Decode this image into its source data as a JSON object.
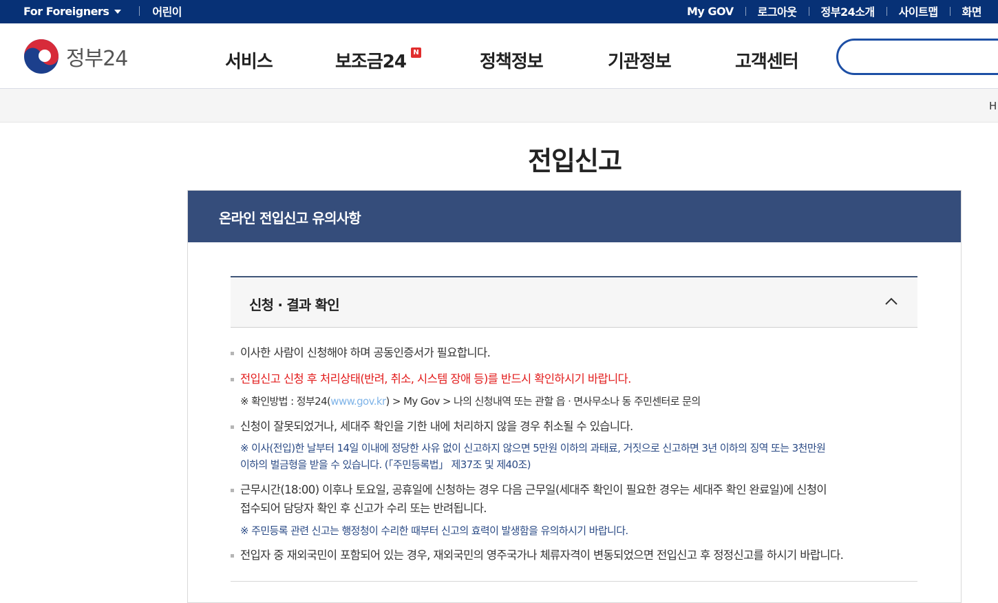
{
  "topbar": {
    "for_foreigners": "For Foreigners",
    "kids": "어린이",
    "my_gov": "My GOV",
    "logout": "로그아웃",
    "about": "정부24소개",
    "sitemap": "사이트맵",
    "screen": "화면"
  },
  "logo": {
    "text": "정부24"
  },
  "gnb": {
    "services": "서비스",
    "subsidy": "보조금24",
    "subsidy_badge": "N",
    "policy": "정책정보",
    "agency": "기관정보",
    "customer": "고객센터"
  },
  "search": {
    "placeholder": ""
  },
  "location": {
    "home": "H"
  },
  "page": {
    "title": "전입신고"
  },
  "notice": {
    "title": "온라인 전입신고 유의사항",
    "section_title": "신청 · 결과 확인",
    "item1": "이사한 사람이 신청해야 하며 공동인증서가 필요합니다.",
    "item2": "전입신고 신청 후 처리상태(반려, 취소, 시스템 장애 등)를 반드시 확인하시기 바랍니다.",
    "note2_pre": "※ 확인방법 : 정부24(",
    "note2_link": "www.gov.kr",
    "note2_post": ") > My Gov > 나의 신청내역 또는 관할 읍 · 면사무소나 동 주민센터로 문의",
    "item3": "신청이 잘못되었거나, 세대주 확인을 기한 내에 처리하지 않을 경우 취소될 수 있습니다.",
    "note3_line1": "※ 이사(전입)한 날부터 14일 이내에 정당한 사유 없이 신고하지 않으면 5만원 이하의 과태료, 거짓으로 신고하면 3년 이하의 징역 또는 3천만원",
    "note3_line2": "이하의 벌금형을 받을 수 있습니다. (「주민등록법」 제37조 및 제40조)",
    "item4_line1": "근무시간(18:00) 이후나 토요일, 공휴일에 신청하는 경우 다음 근무일(세대주 확인이 필요한 경우는 세대주 확인 완료일)에 신청이",
    "item4_line2": "접수되어 담당자 확인 후 신고가 수리 또는 반려됩니다.",
    "note4": "※ 주민등록 관련 신고는 행정청이 수리한 때부터 신고의 효력이 발생함을 유의하시기 바랍니다.",
    "item5": "전입자 중 재외국민이 포함되어 있는 경우, 재외국민의 영주국가나 체류자격이 변동되었으면 전입신고 후 정정신고를 하시기 바랍니다."
  },
  "colors": {
    "topbar": "#073176",
    "notice_header": "#354d7b",
    "warning_red": "#e21b1b",
    "note_blue": "#2a4a85",
    "link": "#7fb4e8"
  }
}
